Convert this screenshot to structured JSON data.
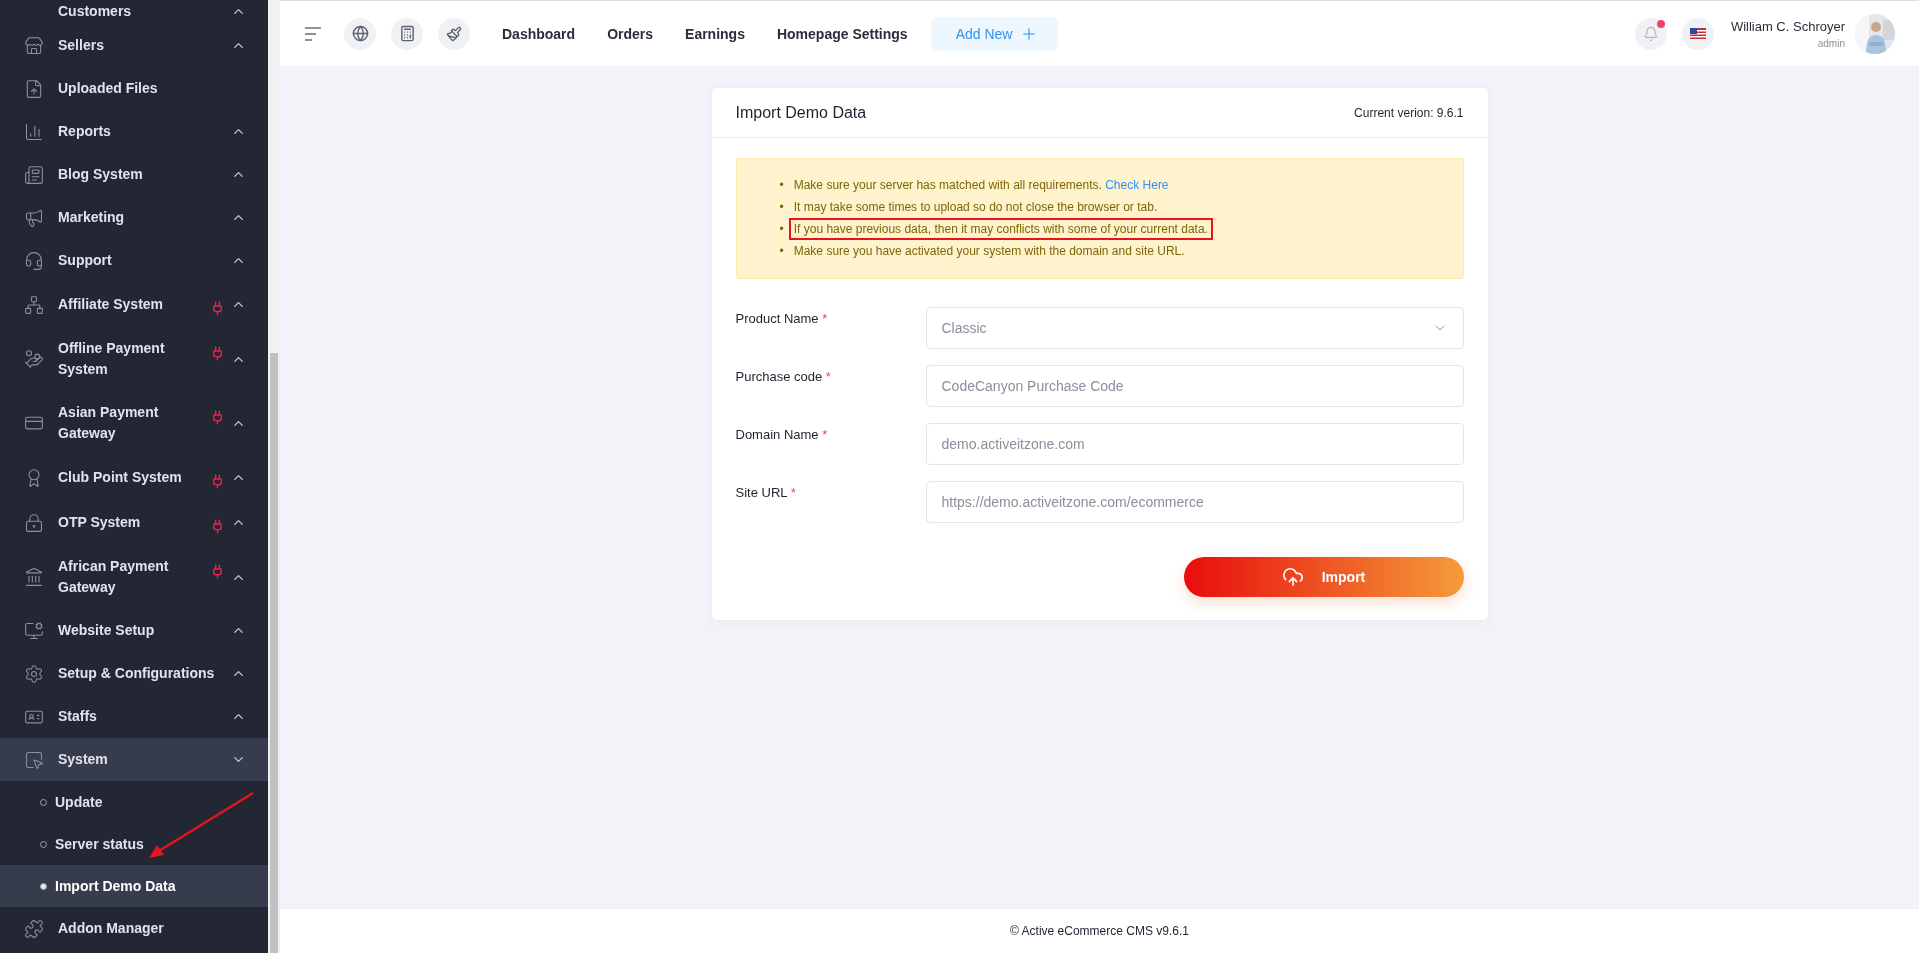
{
  "sidebar": {
    "items": [
      {
        "label": "Customers",
        "addon": false,
        "expandable": true,
        "expanded": false
      },
      {
        "label": "Sellers",
        "addon": false,
        "expandable": true,
        "expanded": false
      },
      {
        "label": "Uploaded Files",
        "addon": false,
        "expandable": false,
        "expanded": false
      },
      {
        "label": "Reports",
        "addon": false,
        "expandable": true,
        "expanded": false
      },
      {
        "label": "Blog System",
        "addon": false,
        "expandable": true,
        "expanded": false
      },
      {
        "label": "Marketing",
        "addon": false,
        "expandable": true,
        "expanded": false
      },
      {
        "label": "Support",
        "addon": false,
        "expandable": true,
        "expanded": false
      },
      {
        "label": "Affiliate System",
        "addon": true,
        "expandable": true,
        "expanded": false
      },
      {
        "label": "Offline Payment System",
        "addon": true,
        "expandable": true,
        "expanded": false
      },
      {
        "label": "Asian Payment Gateway",
        "addon": true,
        "expandable": true,
        "expanded": false
      },
      {
        "label": "Club Point System",
        "addon": true,
        "expandable": true,
        "expanded": false
      },
      {
        "label": "OTP System",
        "addon": true,
        "expandable": true,
        "expanded": false
      },
      {
        "label": "African Payment Gateway",
        "addon": true,
        "expandable": true,
        "expanded": false
      },
      {
        "label": "Website Setup",
        "addon": false,
        "expandable": true,
        "expanded": false
      },
      {
        "label": "Setup & Configurations",
        "addon": false,
        "expandable": true,
        "expanded": false
      },
      {
        "label": "Staffs",
        "addon": false,
        "expandable": true,
        "expanded": false
      },
      {
        "label": "System",
        "addon": false,
        "expandable": true,
        "expanded": true,
        "children": [
          {
            "label": "Update",
            "selected": false
          },
          {
            "label": "Server status",
            "selected": false
          },
          {
            "label": "Import Demo Data",
            "selected": true
          }
        ]
      },
      {
        "label": "Addon Manager",
        "addon": false,
        "expandable": false,
        "expanded": false
      }
    ]
  },
  "topbar": {
    "nav": [
      "Dashboard",
      "Orders",
      "Earnings",
      "Homepage Settings"
    ],
    "add_new": "Add New",
    "notifications_unread": true,
    "user": {
      "name": "William C. Schroyer",
      "role": "admin"
    }
  },
  "card": {
    "title": "Import Demo Data",
    "version": "Current verion: 9.6.1",
    "notes": [
      {
        "marker": "•",
        "text": "Make sure your server has matched with all requirements.",
        "link": "Check Here",
        "highlighted": false
      },
      {
        "marker": "•",
        "text": "It may take some times to upload so do not close the browser or tab.",
        "highlighted": false
      },
      {
        "marker": "•",
        "text": "If you have previous data, then it may conflicts with some of your current data.",
        "highlighted": true
      },
      {
        "marker": "•",
        "text": "Make sure you have activated your system with the domain and site URL.",
        "highlighted": false
      }
    ],
    "fields": [
      {
        "kind": "select",
        "label": "Product Name",
        "required_mark": "*",
        "value": "Classic"
      },
      {
        "kind": "input",
        "label": "Purchase code",
        "required_mark": "*",
        "placeholder": "CodeCanyon Purchase Code"
      },
      {
        "kind": "input",
        "label": "Domain Name",
        "required_mark": "*",
        "placeholder": "demo.activeitzone.com"
      },
      {
        "kind": "input",
        "label": "Site URL",
        "required_mark": "*",
        "placeholder": "https://demo.activeitzone.com/ecommerce"
      }
    ],
    "submit": "Import"
  },
  "footer": "© Active eCommerce CMS v9.6.1",
  "annotation_arrow": true
}
